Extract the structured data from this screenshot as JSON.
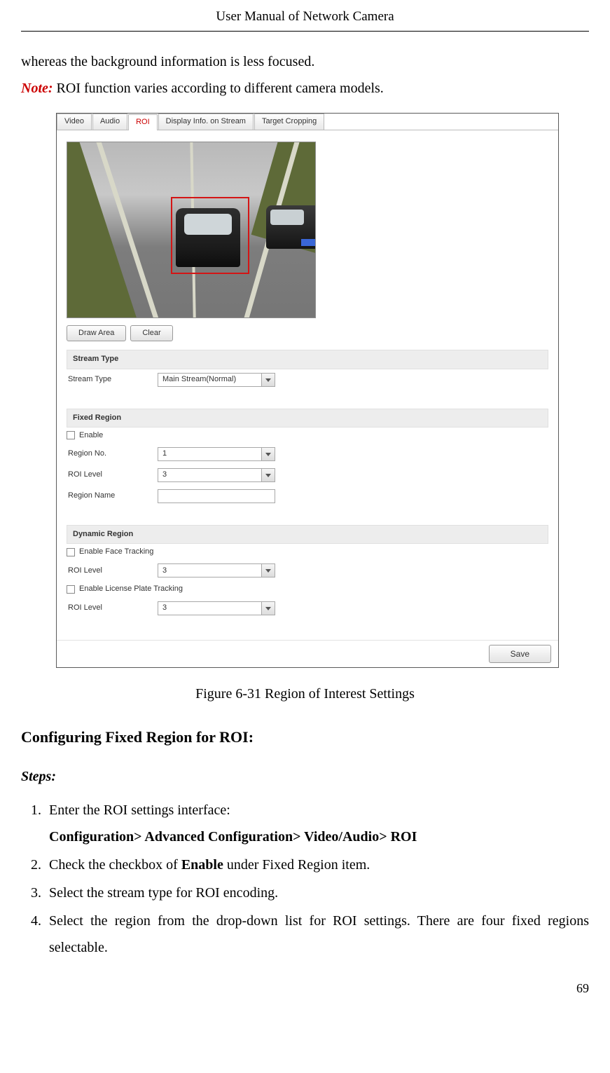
{
  "header_title": "User Manual of Network Camera",
  "intro_line": "whereas the background information is less focused.",
  "note_label": "Note:",
  "note_text": " ROI function varies according to different camera models.",
  "figure": {
    "tabs": [
      "Video",
      "Audio",
      "ROI",
      "Display Info. on Stream",
      "Target Cropping"
    ],
    "active_tab_index": 2,
    "buttons": {
      "draw": "Draw Area",
      "clear": "Clear"
    },
    "stream_type": {
      "header": "Stream Type",
      "label": "Stream Type",
      "value": "Main Stream(Normal)"
    },
    "fixed_region": {
      "header": "Fixed Region",
      "enable_label": "Enable",
      "region_no_label": "Region No.",
      "region_no_value": "1",
      "roi_level_label": "ROI Level",
      "roi_level_value": "3",
      "region_name_label": "Region Name",
      "region_name_value": ""
    },
    "dynamic_region": {
      "header": "Dynamic Region",
      "face_label": "Enable Face Tracking",
      "roi_level_label": "ROI Level",
      "roi_level_value_1": "3",
      "plate_label": "Enable License Plate Tracking",
      "roi_level_value_2": "3"
    },
    "save_label": "Save"
  },
  "figure_caption": "Figure 6-31 Region of Interest Settings",
  "section_heading": "Configuring Fixed Region for ROI:",
  "steps_heading": "Steps:",
  "steps": {
    "s1_a": "Enter the ROI settings interface:",
    "s1_b": "Configuration> Advanced Configuration> Video/Audio> ROI",
    "s2_a": "Check the checkbox of ",
    "s2_b": "Enable",
    "s2_c": " under Fixed Region item.",
    "s3": "Select the stream type for ROI encoding.",
    "s4": "Select the region from the drop-down list for ROI settings. There are four fixed regions selectable."
  },
  "page_number": "69"
}
